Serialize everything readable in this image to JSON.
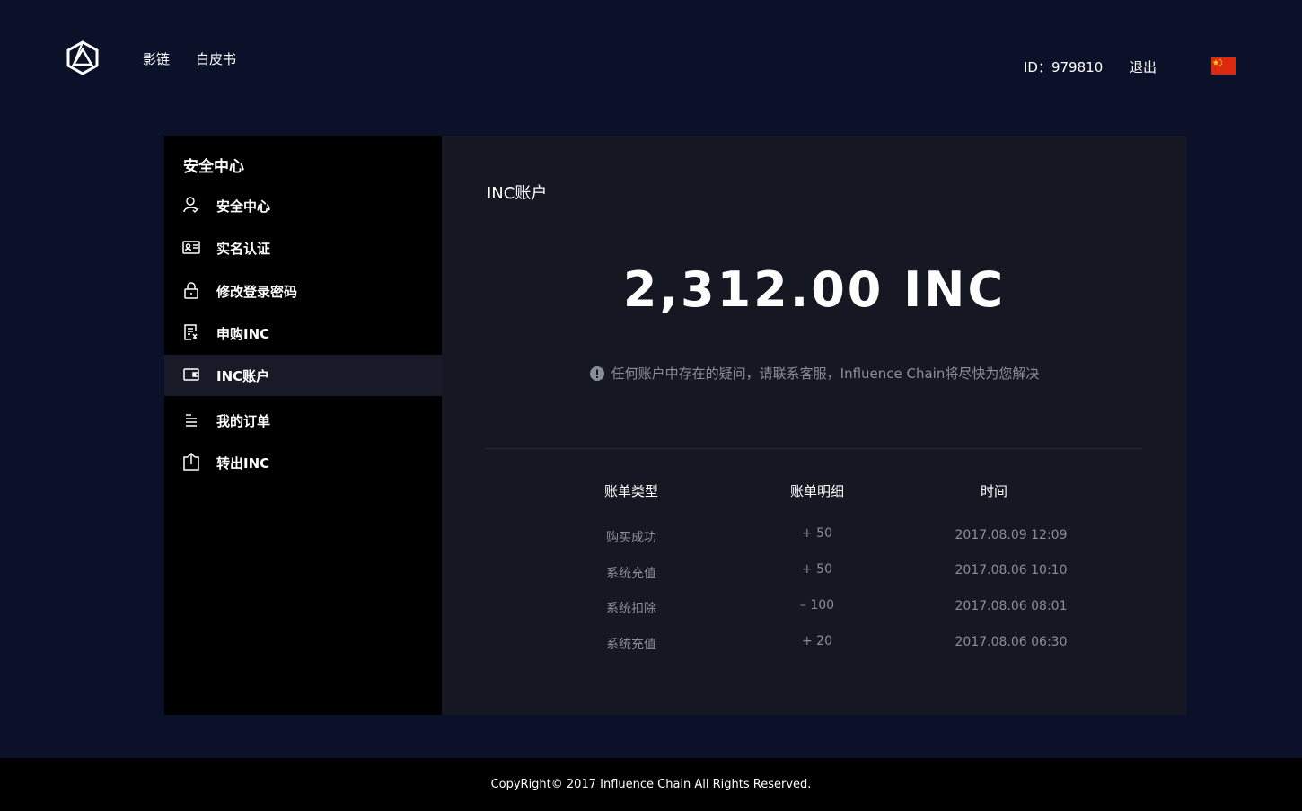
{
  "header": {
    "nav": [
      "影链",
      "白皮书"
    ],
    "user_id": "ID：979810",
    "logout": "退出"
  },
  "sidebar": {
    "title": "安全中心",
    "items": [
      {
        "label": "安全中心",
        "icon": "user-shield-icon"
      },
      {
        "label": "实名认证",
        "icon": "id-card-icon"
      },
      {
        "label": "修改登录密码",
        "icon": "lock-icon"
      },
      {
        "label": "申购INC",
        "icon": "purchase-doc-icon"
      },
      {
        "label": "INC账户",
        "icon": "wallet-icon",
        "active": true
      },
      {
        "label": "我的订单",
        "icon": "list-icon"
      },
      {
        "label": "转出INC",
        "icon": "upload-icon"
      }
    ]
  },
  "main": {
    "title": "INC账户",
    "balance": "2,312.00 INC",
    "notice": "任何账户中存在的疑问，请联系客服，Influence Chain将尽快为您解决",
    "table": {
      "headers": [
        "账单类型",
        "账单明细",
        "时间"
      ],
      "rows": [
        [
          "购买成功",
          "+ 50",
          "2017.08.09 12:09"
        ],
        [
          "系统充值",
          "+ 50",
          "2017.08.06 10:10"
        ],
        [
          "系统扣除",
          "– 100",
          "2017.08.06 08:01"
        ],
        [
          "系统充值",
          "+ 20",
          "2017.08.06 06:30"
        ]
      ]
    }
  },
  "footer": "CopyRight© 2017 Influence Chain All Rights Reserved.",
  "colors": {
    "page_bg": "#0b1128",
    "sidebar_bg": "#000000",
    "active_item_bg": "#181b27",
    "panel_bg": "#151822",
    "muted_text": "#8a8e9a",
    "flag_red": "#de2910"
  }
}
